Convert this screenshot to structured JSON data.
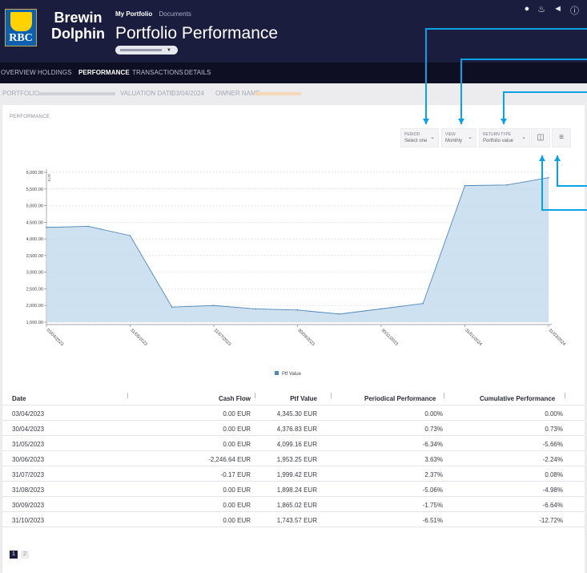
{
  "header": {
    "logo_text": "RBC",
    "brand_line1": "Brewin",
    "brand_line2": "Dolphin",
    "nav_active": "My Portfolio",
    "nav_other": "Documents",
    "title": "Portfolio Performance",
    "icons": [
      "user-icon",
      "bell-icon",
      "megaphone-icon",
      "help-icon"
    ]
  },
  "tabs": [
    "OVERVIEW",
    "HOLDINGS",
    "PERFORMANCE",
    "TRANSACTIONS",
    "DETAILS"
  ],
  "active_tab": "PERFORMANCE",
  "filters": {
    "portfolio_label": "PORTFOLIO",
    "valuation_label": "VALUATION DATE",
    "valuation_date": "03/04/2024",
    "owner_label": "OWNER NAME"
  },
  "card_title": "PERFORMANCE",
  "controls": {
    "period_label": "PERIOD",
    "period_value": "Select one",
    "view_label": "VIEW",
    "view_value": "Monthly",
    "return_label": "RETURN TYPE",
    "return_value": "Portfolio value"
  },
  "chart_data": {
    "type": "area",
    "y_unit": "EUR",
    "ylim": [
      1500,
      6000
    ],
    "y_ticks": [
      "6,000.00",
      "5,500.00",
      "5,000.00",
      "4,500.00",
      "4,000.00",
      "3,500.00",
      "3,000.00",
      "2,500.00",
      "2,000.00",
      "1,500.00"
    ],
    "x_ticks": [
      "03/04/2023",
      "31/05/2023",
      "31/07/2023",
      "30/09/2023",
      "30/11/2023",
      "31/01/2024",
      "31/03/2024"
    ],
    "series": [
      {
        "name": "Ptf Value",
        "color": "#c5dcee",
        "line_color": "#4f87b8",
        "values": [
          4345.3,
          4376.83,
          4099.16,
          1953.25,
          1999.42,
          1898.24,
          1865.02,
          1743.57,
          1900,
          2060,
          5600,
          5620,
          5840
        ]
      }
    ]
  },
  "table": {
    "headers": [
      "Date",
      "Cash Flow",
      "Ptf Value",
      "Periodical Performance",
      "Cumulative Performance"
    ],
    "rows": [
      [
        "03/04/2023",
        "0.00 EUR",
        "4,345.30 EUR",
        "0.00%",
        "0.00%"
      ],
      [
        "30/04/2023",
        "0.00 EUR",
        "4,376.83 EUR",
        "0.73%",
        "0.73%"
      ],
      [
        "31/05/2023",
        "0.00 EUR",
        "4,099.16 EUR",
        "-6.34%",
        "-5.66%"
      ],
      [
        "30/06/2023",
        "-2,246.64 EUR",
        "1,953.25 EUR",
        "3.63%",
        "-2.24%"
      ],
      [
        "31/07/2023",
        "-0.17 EUR",
        "1,999.42 EUR",
        "2.37%",
        "0.08%"
      ],
      [
        "31/08/2023",
        "0.00 EUR",
        "1,898.24 EUR",
        "-5.06%",
        "-4.98%"
      ],
      [
        "30/09/2023",
        "0.00 EUR",
        "1,865.02 EUR",
        "-1.75%",
        "-6.64%"
      ],
      [
        "31/10/2023",
        "0.00 EUR",
        "1,743.57 EUR",
        "-6.51%",
        "-12.72%"
      ]
    ]
  },
  "pagination": [
    "1",
    "2"
  ],
  "annotation_color": "#0aa1e6"
}
